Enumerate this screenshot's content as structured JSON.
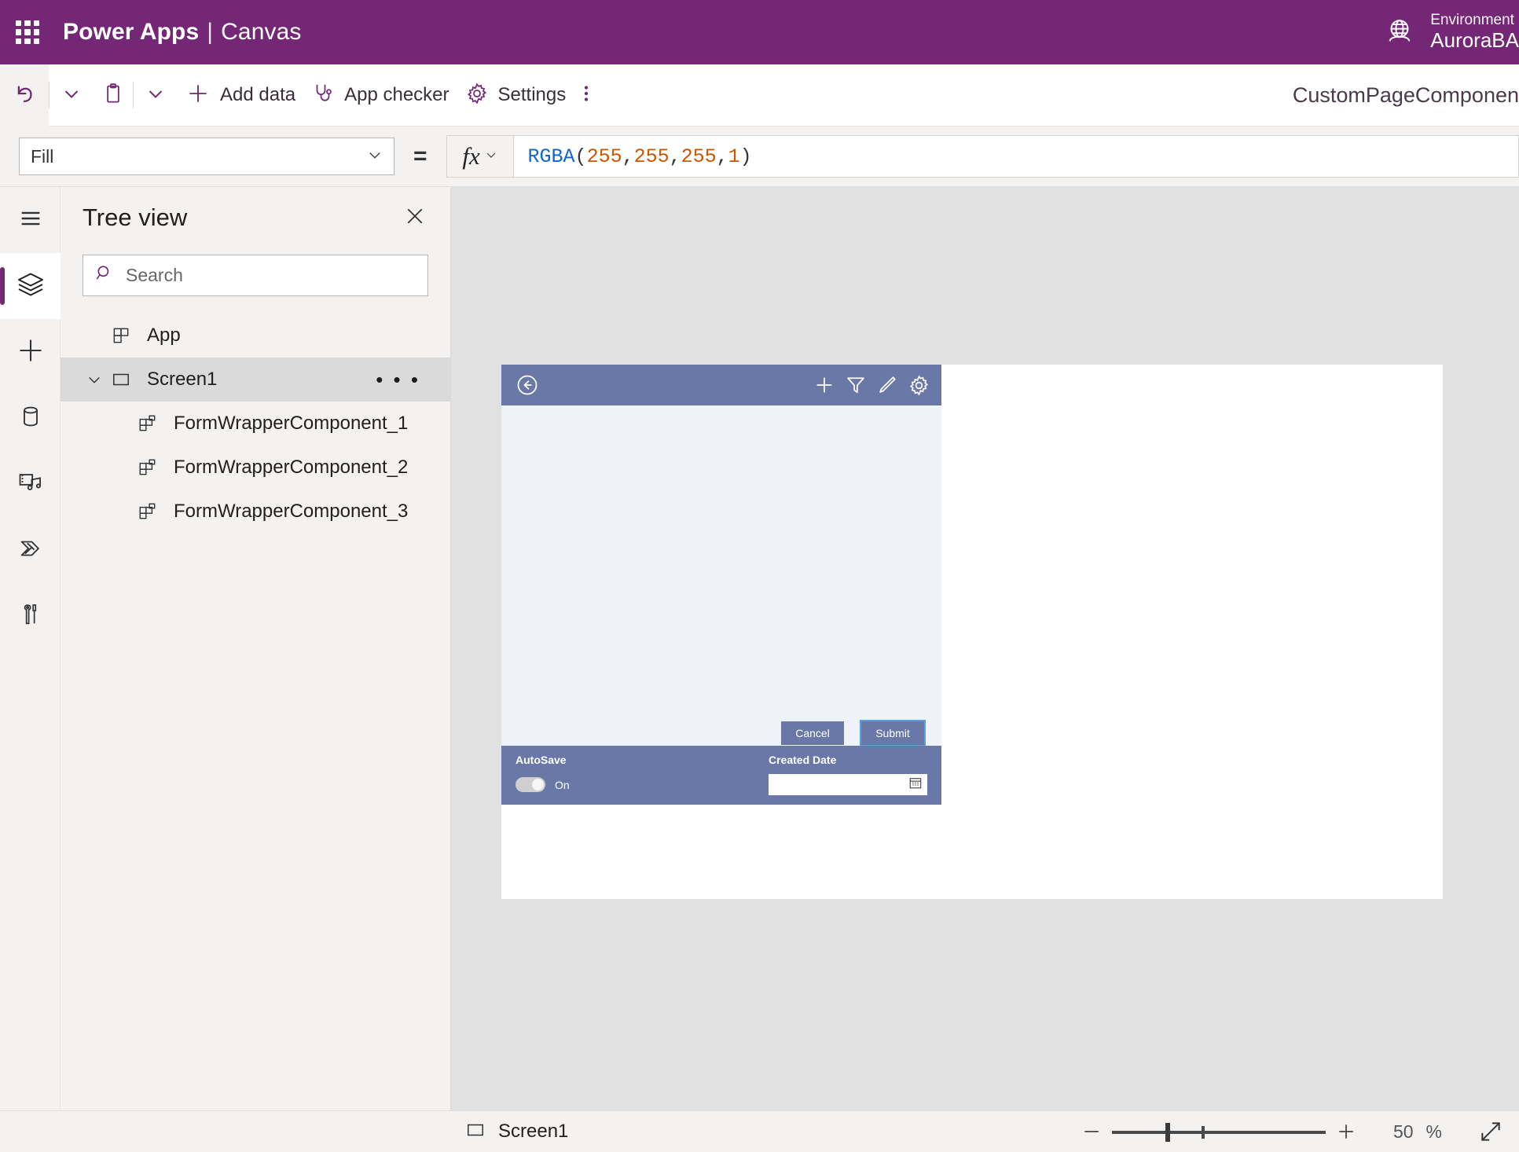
{
  "header": {
    "waffle_icon": "app-launcher-icon",
    "brand_primary": "Power Apps",
    "brand_separator": "|",
    "brand_secondary": "Canvas",
    "globe_icon": "environment-globe-icon",
    "environment_label": "Environment",
    "environment_name": "AuroraBA",
    "brand_color": "#742774"
  },
  "commandbar": {
    "undo_icon": "undo-icon",
    "undo_caret_icon": "chevron-down-icon",
    "paste_icon": "clipboard-paste-icon",
    "paste_caret_icon": "chevron-down-icon",
    "add_data_icon": "plus-icon",
    "add_data_label": "Add data",
    "app_checker_icon": "stethoscope-icon",
    "app_checker_label": "App checker",
    "settings_icon": "gear-icon",
    "settings_label": "Settings",
    "overflow_icon": "more-vertical-icon",
    "document_title": "CustomPageComponen"
  },
  "formulabar": {
    "property_value": "Fill",
    "property_caret_icon": "chevron-down-icon",
    "equals": "=",
    "fx_label": "fx",
    "fx_caret_icon": "chevron-down-icon",
    "formula_text": "RGBA(255, 255, 255, 1)",
    "tokens": {
      "fn": "RGBA",
      "open": "(",
      "n1": "255",
      "c1": ", ",
      "n2": "255",
      "c2": ", ",
      "n3": "255",
      "c3": ", ",
      "n4": "1",
      "close": ")"
    },
    "fn_color": "#1166cc",
    "num_color": "#cc5500"
  },
  "rail": {
    "items": [
      {
        "icon": "hamburger-menu-icon",
        "name": "menu",
        "active": false
      },
      {
        "icon": "layers-icon",
        "name": "tree-view",
        "active": true
      },
      {
        "icon": "plus-icon",
        "name": "insert",
        "active": false
      },
      {
        "icon": "database-icon",
        "name": "data",
        "active": false
      },
      {
        "icon": "media-icon",
        "name": "media",
        "active": false
      },
      {
        "icon": "power-automate-icon",
        "name": "power-automate",
        "active": false
      },
      {
        "icon": "tools-icon",
        "name": "advanced-tools",
        "active": false
      }
    ]
  },
  "treeview": {
    "title": "Tree view",
    "close_icon": "close-icon",
    "search_icon": "search-icon",
    "search_placeholder": "Search",
    "search_value": "",
    "rows": [
      {
        "label": "App",
        "icon": "app-icon",
        "indent": 0,
        "selected": false,
        "chevron": "",
        "dots": ""
      },
      {
        "label": "Screen1",
        "icon": "screen-icon",
        "indent": 0,
        "selected": true,
        "chevron": "chevron-down-icon",
        "dots": "• • •"
      },
      {
        "label": "FormWrapperComponent_1",
        "icon": "component-icon",
        "indent": 1,
        "selected": false,
        "chevron": "",
        "dots": ""
      },
      {
        "label": "FormWrapperComponent_2",
        "icon": "component-icon",
        "indent": 1,
        "selected": false,
        "chevron": "",
        "dots": ""
      },
      {
        "label": "FormWrapperComponent_3",
        "icon": "component-icon",
        "indent": 1,
        "selected": false,
        "chevron": "",
        "dots": ""
      }
    ]
  },
  "canvas": {
    "app_header_color": "#6a78a8",
    "form_background": "#eef2f9",
    "page_background": "#ffffff",
    "back_icon": "back-arrow-circle-icon",
    "toolbar_icons": [
      "plus-icon",
      "filter-icon",
      "pencil-icon",
      "gear-icon"
    ],
    "cancel_label": "Cancel",
    "submit_label": "Submit",
    "autosave_label": "AutoSave",
    "autosave_state": "On",
    "created_date_label": "Created Date",
    "created_date_value": "",
    "calendar_icon": "calendar-icon"
  },
  "statusbar": {
    "screen_icon": "screen-icon",
    "screen_label": "Screen1",
    "zoom_out_icon": "minus-icon",
    "zoom_in_icon": "plus-icon",
    "zoom_value": "50",
    "zoom_unit": "%",
    "expand_icon": "expand-diagonal-icon"
  }
}
